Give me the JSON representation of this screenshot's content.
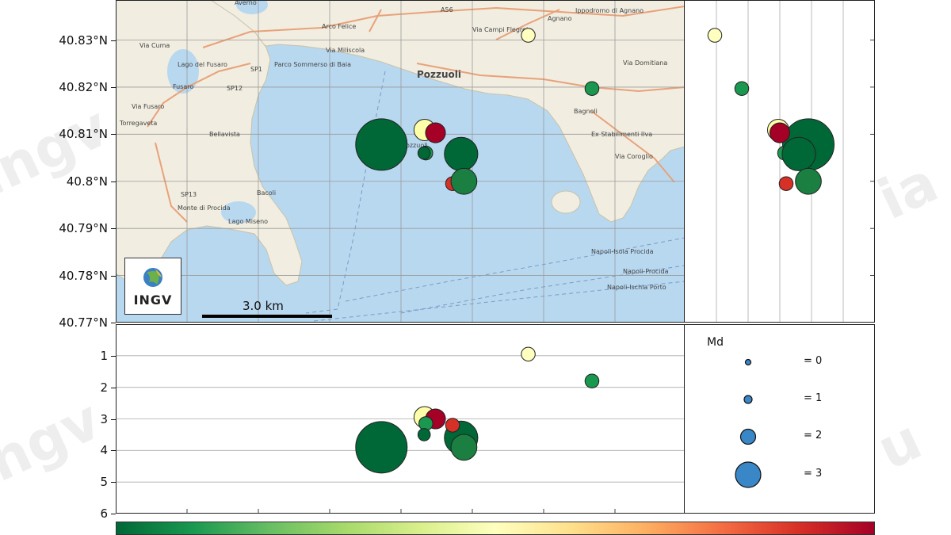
{
  "map": {
    "lat_ticks": [
      {
        "label": "40.83°N",
        "lat": 40.83
      },
      {
        "label": "40.82°N",
        "lat": 40.82
      },
      {
        "label": "40.81°N",
        "lat": 40.81
      },
      {
        "label": "40.8°N",
        "lat": 40.8
      },
      {
        "label": "40.79°N",
        "lat": 40.79
      },
      {
        "label": "40.78°N",
        "lat": 40.78
      },
      {
        "label": "40.77°N",
        "lat": 40.77
      }
    ],
    "place_labels": [
      "Averno",
      "Arco Felice",
      "Agnano",
      "Ippodromo di Agnano",
      "Lago del Fusaro",
      "Parco Sommerso di Baia",
      "Pozzuoli",
      "Fusaro",
      "Torregaveta",
      "Bellavista",
      "Golfo di Pozzuoli",
      "Bagnoli",
      "Ex Stabilimenti Ilva",
      "Bacoli",
      "Monte di Procida",
      "Lago Miseno",
      "A56",
      "SP1",
      "SP12",
      "SP13",
      "Via Campi Flegrei",
      "Via Miliscola",
      "Via Fusaro",
      "Via Cuma",
      "Via Domitiana",
      "Via Coroglio",
      "Napoli-Isola Procida",
      "Napoli-Procida",
      "Napoli-Ischia Porto"
    ],
    "scalebar_label": "3.0 km",
    "logo_text": "INGV",
    "water_color": "#b8d8f0",
    "land_color": "#f1ede0"
  },
  "depth_axis": {
    "ticks": [
      {
        "label": "1",
        "value": 1
      },
      {
        "label": "2",
        "value": 2
      },
      {
        "label": "3",
        "value": 3
      },
      {
        "label": "4",
        "value": 4
      },
      {
        "label": "5",
        "value": 5
      },
      {
        "label": "6",
        "value": 6
      }
    ]
  },
  "legend": {
    "title": "Md",
    "entries": [
      {
        "label": "= 0",
        "md": 0
      },
      {
        "label": "= 1",
        "md": 1
      },
      {
        "label": "= 2",
        "md": 2
      },
      {
        "label": "= 3",
        "md": 3
      }
    ],
    "color": "#3a87c8"
  },
  "colorbar": {
    "colors": [
      "#006837",
      "#1a9850",
      "#66bd63",
      "#a6d96a",
      "#d9ef8b",
      "#ffffbf",
      "#fee08b",
      "#fdae61",
      "#f46d43",
      "#d73027",
      "#a50026"
    ]
  },
  "events": [
    {
      "lon": 14.1062,
      "lat": 40.8078,
      "depth": 3.9,
      "md": 3.0,
      "color": "#006837"
    },
    {
      "lon": 14.1138,
      "lat": 40.8109,
      "depth": 2.95,
      "md": 1.0,
      "color": "#ffffaa"
    },
    {
      "lon": 14.1157,
      "lat": 40.8103,
      "depth": 3.0,
      "md": 0.9,
      "color": "#a50026"
    },
    {
      "lon": 14.114,
      "lat": 40.806,
      "depth": 3.15,
      "md": 0.5,
      "color": "#1a9850"
    },
    {
      "lon": 14.1137,
      "lat": 40.806,
      "depth": 3.5,
      "md": 0.4,
      "color": "#006837"
    },
    {
      "lon": 14.1202,
      "lat": 40.8058,
      "depth": 3.6,
      "md": 1.8,
      "color": "#006837"
    },
    {
      "lon": 14.1187,
      "lat": 40.7995,
      "depth": 3.2,
      "md": 0.5,
      "color": "#d73027"
    },
    {
      "lon": 14.1207,
      "lat": 40.8,
      "depth": 3.9,
      "md": 1.3,
      "color": "#1a7f40"
    },
    {
      "lon": 14.132,
      "lat": 40.831,
      "depth": 0.95,
      "md": 0.5,
      "color": "#ffffbf"
    },
    {
      "lon": 14.1432,
      "lat": 40.8197,
      "depth": 1.8,
      "md": 0.5,
      "color": "#1a9850"
    }
  ]
}
